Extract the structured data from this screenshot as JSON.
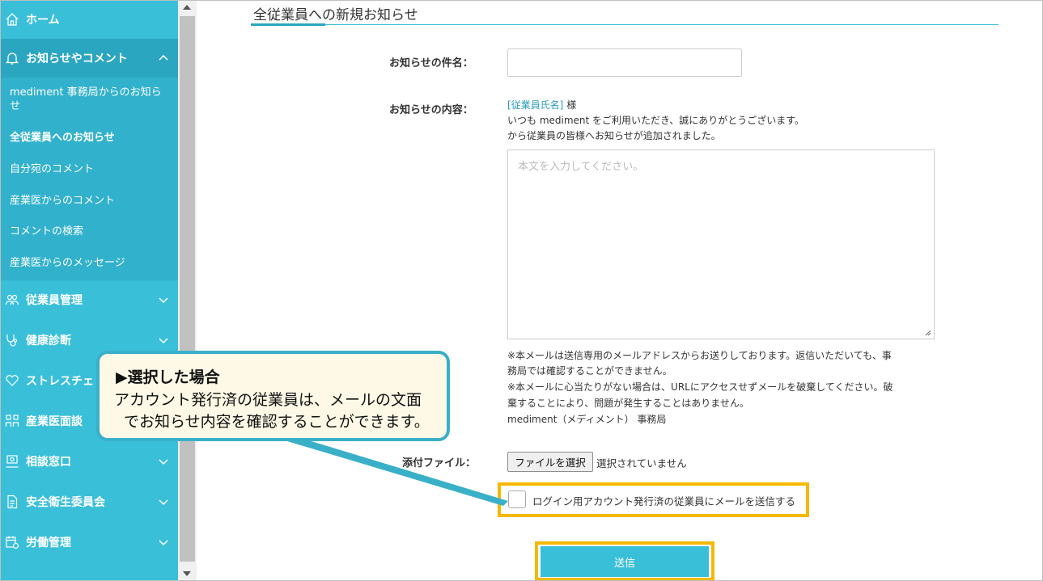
{
  "sidebar": {
    "home": "ホーム",
    "notices": "お知らせやコメント",
    "sub_items": [
      "mediment 事務局からのお知らせ",
      "全従業員へのお知らせ",
      "自分宛のコメント",
      "産業医からのコメント",
      "コメントの検索",
      "産業医からのメッセージ"
    ],
    "employee_management": "従業員管理",
    "health_checkup": "健康診断",
    "stress_check": "ストレスチェ",
    "occupational_interview": "産業医面談",
    "consultation": "相談窓口",
    "safety_committee": "安全衛生委員会",
    "labor_management": "労働管理",
    "icons": {
      "home": "home-icon",
      "notices": "bell-icon",
      "employee_management": "users-icon",
      "health_checkup": "stethoscope-icon",
      "stress_check": "heart-icon",
      "occupational_interview": "people-icon",
      "consultation": "consultation-icon",
      "safety_committee": "document-icon",
      "labor_management": "calendar-icon"
    }
  },
  "main": {
    "title": "全従業員への新規お知らせ",
    "subject_label": "お知らせの件名：",
    "content_label": "お知らせの内容：",
    "mail_template": {
      "name_placeholder": "[従業員氏名]",
      "honorific": "様",
      "greeting": "いつも mediment をご利用いただき、誠にありがとうございます。",
      "intro": "から従業員の皆様へお知らせが追加されました。"
    },
    "body_placeholder": "本文を入力してください。",
    "notes": [
      "※本メールは送信専用のメールアドレスからお送りしております。返信いただいても、事",
      "務局では確認することができません。",
      "※本メールに心当たりがない場合は、URLにアクセスせずメールを破棄してください。破",
      "棄することにより、問題が発生することはありません。",
      "mediment（メディメント） 事務局"
    ],
    "attachment_label": "添付ファイル：",
    "file_button": "ファイルを選択",
    "file_status": "選択されていません",
    "send_mail_checkbox": "ログイン用アカウント発行済の従業員にメールを送信する",
    "submit": "送信"
  },
  "callout": {
    "title": "▶選択した場合",
    "line1": "アカウント発行済の従業員は、メールの文面",
    "line2": "でお知らせ内容を確認することができます。"
  },
  "colors": {
    "accent": "#3abfd9",
    "highlight": "#f5b800",
    "callout_bg": "#fdf9e6"
  }
}
